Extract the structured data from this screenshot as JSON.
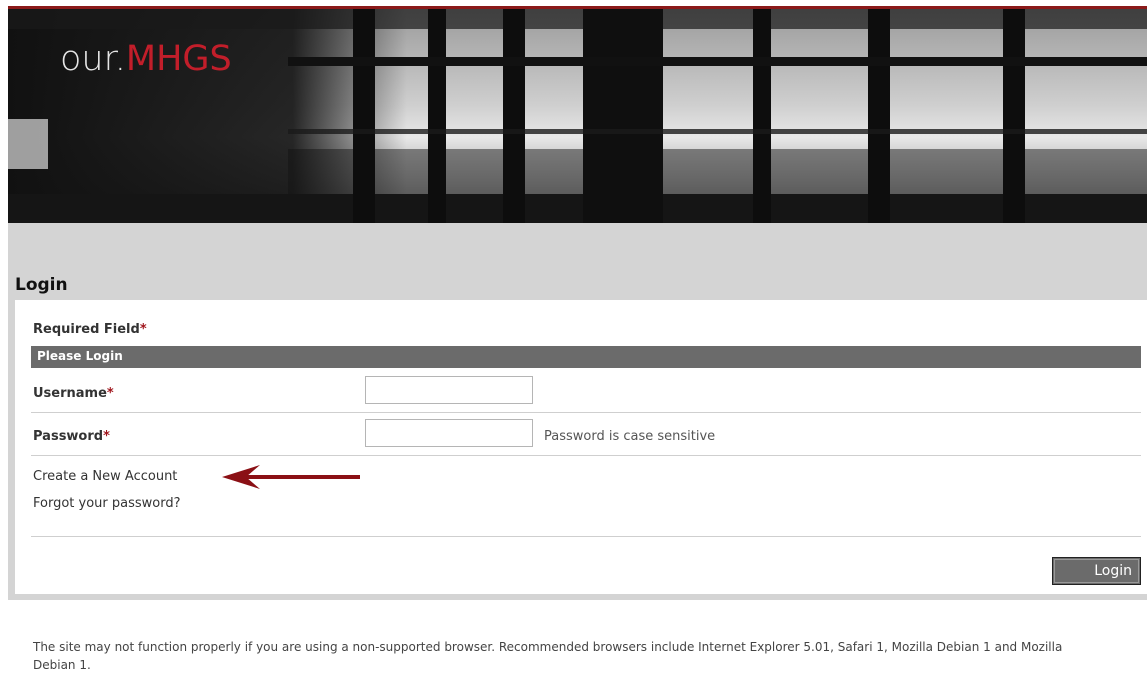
{
  "banner": {
    "logo_prefix": "our.",
    "logo_brand": "MHGS",
    "colors": {
      "brand_red": "#c21e2a",
      "top_rule": "#8b1a1a"
    }
  },
  "login": {
    "title": "Login",
    "required_label": "Required Field",
    "required_mark": "*",
    "section_title": "Please Login",
    "username_label": "Username",
    "username_value": "",
    "password_label": "Password",
    "password_value": "",
    "password_hint": "Password is case sensitive",
    "create_account_link": "Create a New Account",
    "forgot_password_link": "Forgot your password?",
    "submit_label": "Login",
    "annotation_arrow": "arrow-left-icon",
    "annotation_color": "#8b1015"
  },
  "footer": {
    "notice": "The site may not function properly if you are using a non-supported browser. Recommended browsers include Internet Explorer 5.01, Safari 1, Mozilla Debian 1 and Mozilla Debian 1."
  }
}
